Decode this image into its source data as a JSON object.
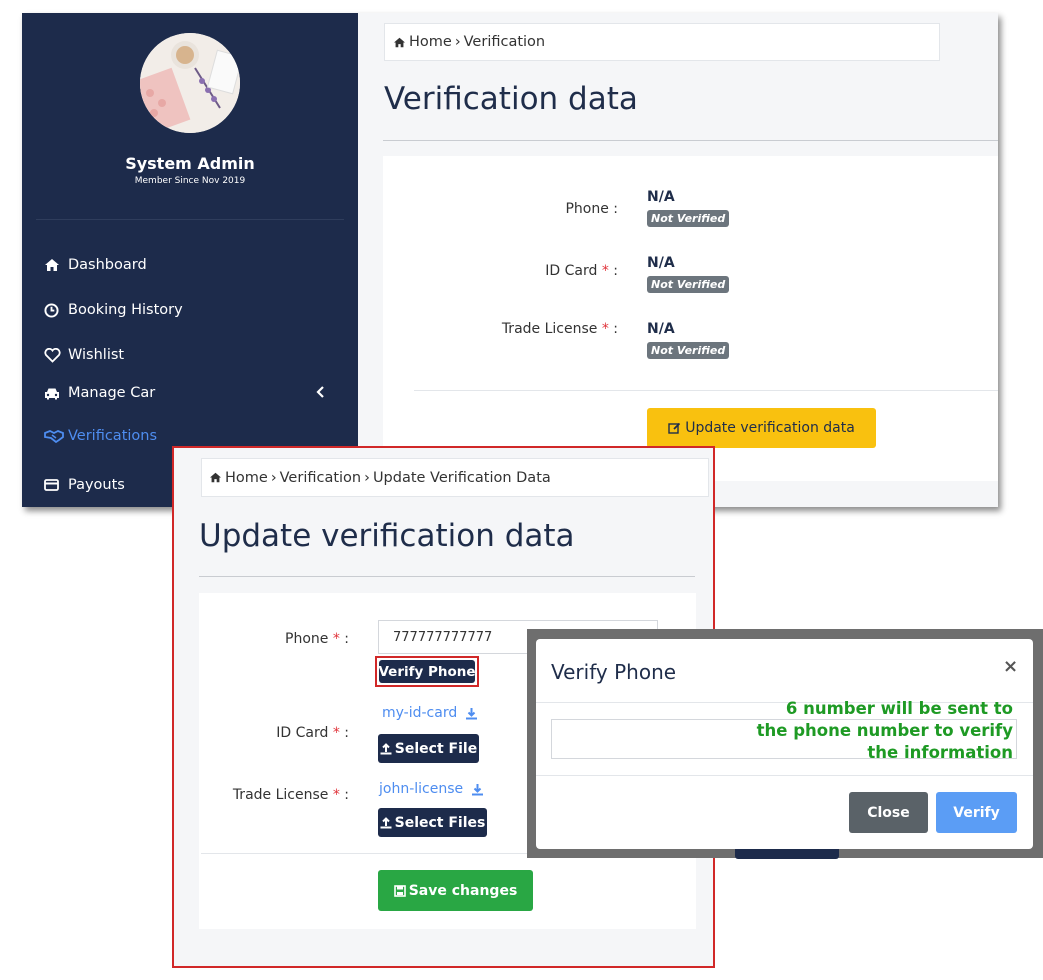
{
  "sidebar": {
    "user_name": "System Admin",
    "member_since": "Member Since Nov 2019",
    "items": [
      {
        "label": "Dashboard",
        "icon": "home-icon"
      },
      {
        "label": "Booking History",
        "icon": "clock-icon"
      },
      {
        "label": "Wishlist",
        "icon": "heart-icon"
      },
      {
        "label": "Manage Car",
        "icon": "car-icon"
      },
      {
        "label": "Verifications",
        "icon": "handshake-icon",
        "active": true
      },
      {
        "label": "Payouts",
        "icon": "credit-card-icon"
      }
    ]
  },
  "main": {
    "breadcrumb": [
      "Home",
      "Verification"
    ],
    "title": "Verification data",
    "fields": [
      {
        "label": "Phone",
        "required": false,
        "value": "N/A",
        "status": "Not Verified"
      },
      {
        "label": "ID Card",
        "required": true,
        "value": "N/A",
        "status": "Not Verified"
      },
      {
        "label": "Trade License",
        "required": true,
        "value": "N/A",
        "status": "Not Verified"
      }
    ],
    "update_button": "Update verification data"
  },
  "update_form": {
    "breadcrumb": [
      "Home",
      "Verification",
      "Update Verification Data"
    ],
    "title": "Update verification data",
    "phone_label": "Phone",
    "phone_value": "777777777777",
    "verify_phone_button": "Verify Phone",
    "id_card_label": "ID Card",
    "id_card_file": "my-id-card",
    "select_file_button": "Select File",
    "trade_license_label": "Trade License",
    "trade_license_file": "john-license",
    "select_files_button": "Select Files",
    "save_button": "Save changes",
    "required_mark": "*",
    "colon": ":"
  },
  "modal": {
    "title": "Verify Phone",
    "close_symbol": "×",
    "note": "6 number will be sent to the phone number to verify the information",
    "close_button": "Close",
    "verify_button": "Verify"
  },
  "colors": {
    "sidebar_bg": "#1d2b4b",
    "accent_blue": "#4e8df0",
    "warning": "#f9c10f",
    "success": "#29a744",
    "highlight_red": "#d12828",
    "note_green": "#1e9a24"
  }
}
